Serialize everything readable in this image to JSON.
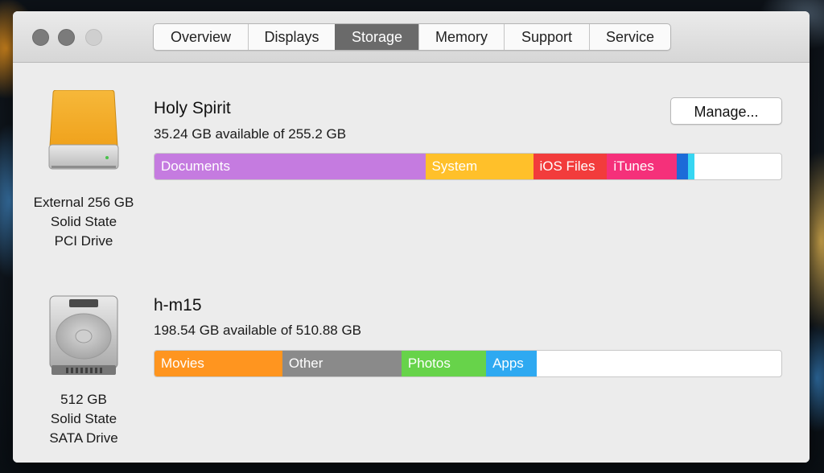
{
  "window": {
    "tabs": [
      {
        "label": "Overview"
      },
      {
        "label": "Displays"
      },
      {
        "label": "Storage"
      },
      {
        "label": "Memory"
      },
      {
        "label": "Support"
      },
      {
        "label": "Service"
      }
    ],
    "active_tab": "Storage"
  },
  "drives": [
    {
      "icon": "external-drive-icon",
      "description": [
        "External 256 GB",
        "Solid State",
        "PCI Drive"
      ],
      "volume_name": "Holy Spirit",
      "availability": "35.24 GB available of 255.2 GB",
      "manage_label": "Manage...",
      "segments": [
        {
          "label": "Documents",
          "color": "#c57be0",
          "fraction": 0.432
        },
        {
          "label": "System",
          "color": "#ffc02a",
          "fraction": 0.172
        },
        {
          "label": "iOS Files",
          "color": "#f23c3c",
          "fraction": 0.118
        },
        {
          "label": "iTunes",
          "color": "#f5307a",
          "fraction": 0.111
        },
        {
          "label": "",
          "color": "#1c6bd8",
          "fraction": 0.018
        },
        {
          "label": "",
          "color": "#37d6f2",
          "fraction": 0.011
        }
      ]
    },
    {
      "icon": "internal-drive-icon",
      "description": [
        "512 GB",
        "Solid State",
        "SATA Drive"
      ],
      "volume_name": "h-m15",
      "availability": "198.54 GB available of 510.88 GB",
      "segments": [
        {
          "label": "Movies",
          "color": "#ff951f",
          "fraction": 0.204
        },
        {
          "label": "Other",
          "color": "#8a8a8a",
          "fraction": 0.19
        },
        {
          "label": "Photos",
          "color": "#67d34a",
          "fraction": 0.135
        },
        {
          "label": "Apps",
          "color": "#2ea9f1",
          "fraction": 0.081
        }
      ]
    }
  ]
}
